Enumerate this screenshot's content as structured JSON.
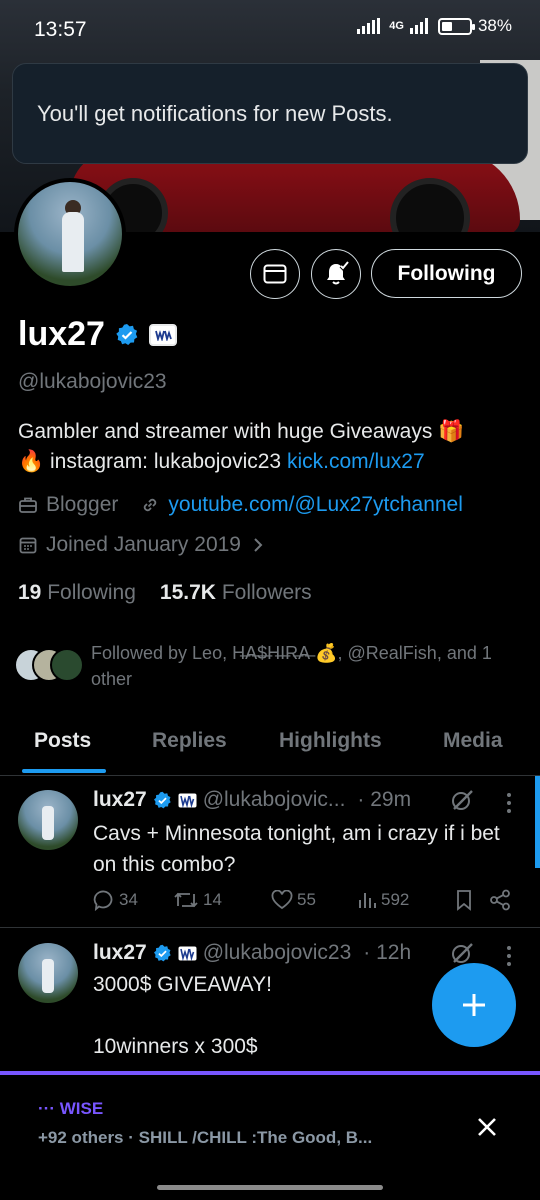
{
  "status": {
    "time": "13:57",
    "network": "4G",
    "battery": "38%",
    "battery_level": 0.38
  },
  "toast": {
    "text": "You'll get notifications for new Posts."
  },
  "profile_actions": {
    "following_label": "Following"
  },
  "profile": {
    "name": "lux27",
    "handle": "@lukabojovic23",
    "bio_line1": "Gambler and streamer with huge Giveaways 🎁",
    "bio_line2_prefix": "🔥 instagram: lukabojovic23 ",
    "bio_link": "kick.com/lux27",
    "category": "Blogger",
    "website": "youtube.com/@Lux27ytchannel",
    "joined": "Joined January 2019",
    "following_count": "19",
    "following_label": "Following",
    "followers_count": "15.7K",
    "followers_label": "Followers",
    "followed_by": "Followed by Leo, H̶A̶$̶H̶I̶R̶A̶ 💰, @RealFish, and 1 other"
  },
  "tabs": [
    {
      "label": "Posts"
    },
    {
      "label": "Replies"
    },
    {
      "label": "Highlights"
    },
    {
      "label": "Media"
    }
  ],
  "posts": [
    {
      "name": "lux27",
      "handle": "@lukabojovic...",
      "time": "· 29m",
      "text": "Cavs + Minnesota tonight, am i crazy if i bet on this combo?",
      "replies": "34",
      "reposts": "14",
      "likes": "55",
      "views": "592"
    },
    {
      "name": "lux27",
      "handle": "@lukabojovic23",
      "time": "· 12h",
      "line1": "3000$ GIVEAWAY!",
      "line2": "10winners x 300$"
    }
  ],
  "space": {
    "title": "··· WISE",
    "subtitle": "+92 others · SHILL /CHILL :The Good, B..."
  },
  "colors": {
    "accent": "#1d9bf0",
    "space": "#7856ff",
    "background": "#000000"
  }
}
